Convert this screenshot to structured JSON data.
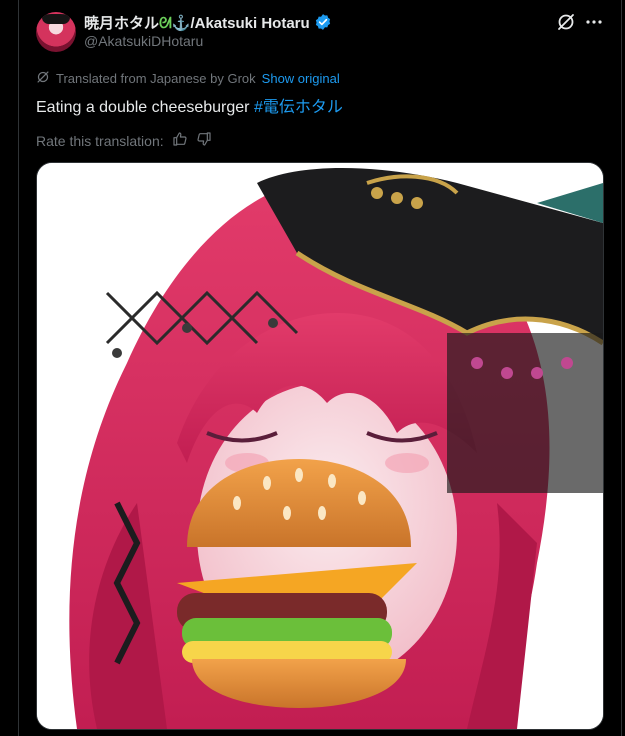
{
  "author": {
    "display_name": "暁月ホタル",
    "name_suffix": "/Akatsuki Hotaru",
    "handle": "@AkatsukiDHotaru",
    "verified_color": "#1d9bf0"
  },
  "translation": {
    "notice": "Translated from Japanese by Grok",
    "show_original": "Show original"
  },
  "tweet": {
    "text": "Eating a double cheeseburger ",
    "hashtag": "#電伝ホタル"
  },
  "rating": {
    "label": "Rate this translation:"
  },
  "icons": {
    "grok": "grok-icon",
    "more": "more-icon",
    "thumbs_up": "thumbs-up-icon",
    "thumbs_down": "thumbs-down-icon"
  },
  "colors": {
    "background": "#000000",
    "text": "#e7e9ea",
    "muted": "#71767b",
    "link": "#1d9bf0"
  }
}
